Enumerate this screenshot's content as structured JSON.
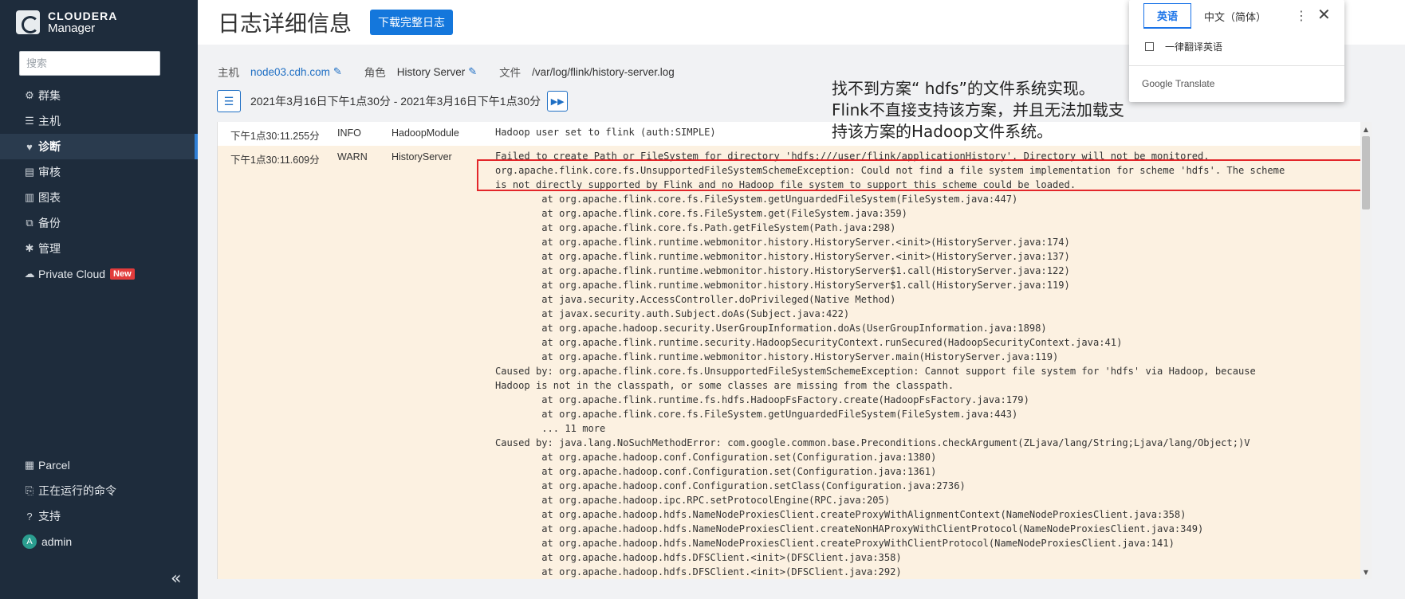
{
  "sidebar": {
    "brand": "CLOUDERA",
    "product": "Manager",
    "search_placeholder": "搜索",
    "items": [
      {
        "label": "群集",
        "icon": "cluster-icon",
        "glyph": "⚙"
      },
      {
        "label": "主机",
        "icon": "host-list-icon",
        "glyph": "☰"
      },
      {
        "label": "诊断",
        "icon": "heartbeat-icon",
        "glyph": "♥"
      },
      {
        "label": "审核",
        "icon": "audit-icon",
        "glyph": "▤"
      },
      {
        "label": "图表",
        "icon": "chart-icon",
        "glyph": "▥"
      },
      {
        "label": "备份",
        "icon": "backup-icon",
        "glyph": "⧉"
      },
      {
        "label": "管理",
        "icon": "gear-icon",
        "glyph": "✱"
      },
      {
        "label": "Private Cloud",
        "icon": "cloud-icon",
        "glyph": "☁",
        "badge": "New"
      }
    ],
    "bottom_items": [
      {
        "label": "Parcel",
        "icon": "parcel-icon",
        "glyph": "▦"
      },
      {
        "label": "正在运行的命令",
        "icon": "commands-icon",
        "glyph": "⎘"
      },
      {
        "label": "支持",
        "icon": "help-icon",
        "glyph": "?"
      },
      {
        "label": "admin",
        "avatar": "A"
      }
    ],
    "collapse_glyph": "«"
  },
  "header": {
    "title": "日志详细信息",
    "download_label": "下载完整日志"
  },
  "meta": {
    "host_label": "主机",
    "host_value": "node03.cdh.com",
    "role_label": "角色",
    "role_value": "History Server",
    "file_label": "文件",
    "file_value": "/var/log/flink/history-server.log"
  },
  "range": {
    "text": "2021年3月16日下午1点30分 - 2021年3月16日下午1点30分"
  },
  "log": {
    "rows": [
      {
        "time": "下午1点30:11.255分",
        "level": "INFO",
        "source": "HadoopModule",
        "message": "Hadoop user set to flink (auth:SIMPLE)"
      },
      {
        "time": "下午1点30:11.609分",
        "level": "WARN",
        "source": "HistoryServer",
        "message": "Failed to create Path or FileSystem for directory 'hdfs:///user/flink/applicationHistory'. Directory will not be monitored.\norg.apache.flink.core.fs.UnsupportedFileSystemSchemeException: Could not find a file system implementation for scheme 'hdfs'. The scheme\nis not directly supported by Flink and no Hadoop file system to support this scheme could be loaded.\n        at org.apache.flink.core.fs.FileSystem.getUnguardedFileSystem(FileSystem.java:447)\n        at org.apache.flink.core.fs.FileSystem.get(FileSystem.java:359)\n        at org.apache.flink.core.fs.Path.getFileSystem(Path.java:298)\n        at org.apache.flink.runtime.webmonitor.history.HistoryServer.<init>(HistoryServer.java:174)\n        at org.apache.flink.runtime.webmonitor.history.HistoryServer.<init>(HistoryServer.java:137)\n        at org.apache.flink.runtime.webmonitor.history.HistoryServer$1.call(HistoryServer.java:122)\n        at org.apache.flink.runtime.webmonitor.history.HistoryServer$1.call(HistoryServer.java:119)\n        at java.security.AccessController.doPrivileged(Native Method)\n        at javax.security.auth.Subject.doAs(Subject.java:422)\n        at org.apache.hadoop.security.UserGroupInformation.doAs(UserGroupInformation.java:1898)\n        at org.apache.flink.runtime.security.HadoopSecurityContext.runSecured(HadoopSecurityContext.java:41)\n        at org.apache.flink.runtime.webmonitor.history.HistoryServer.main(HistoryServer.java:119)\nCaused by: org.apache.flink.core.fs.UnsupportedFileSystemSchemeException: Cannot support file system for 'hdfs' via Hadoop, because\nHadoop is not in the classpath, or some classes are missing from the classpath.\n        at org.apache.flink.runtime.fs.hdfs.HadoopFsFactory.create(HadoopFsFactory.java:179)\n        at org.apache.flink.core.fs.FileSystem.getUnguardedFileSystem(FileSystem.java:443)\n        ... 11 more\nCaused by: java.lang.NoSuchMethodError: com.google.common.base.Preconditions.checkArgument(ZLjava/lang/String;Ljava/lang/Object;)V\n        at org.apache.hadoop.conf.Configuration.set(Configuration.java:1380)\n        at org.apache.hadoop.conf.Configuration.set(Configuration.java:1361)\n        at org.apache.hadoop.conf.Configuration.setClass(Configuration.java:2736)\n        at org.apache.hadoop.ipc.RPC.setProtocolEngine(RPC.java:205)\n        at org.apache.hadoop.hdfs.NameNodeProxiesClient.createProxyWithAlignmentContext(NameNodeProxiesClient.java:358)\n        at org.apache.hadoop.hdfs.NameNodeProxiesClient.createNonHAProxyWithClientProtocol(NameNodeProxiesClient.java:349)\n        at org.apache.hadoop.hdfs.NameNodeProxiesClient.createProxyWithClientProtocol(NameNodeProxiesClient.java:141)\n        at org.apache.hadoop.hdfs.DFSClient.<init>(DFSClient.java:358)\n        at org.apache.hadoop.hdfs.DFSClient.<init>(DFSClient.java:292)"
      }
    ]
  },
  "overlay_translation": {
    "line1": "找不到方案“ hdfs”的文件系统实现。",
    "line2": "Flink不直接支持该方案，并且无法加载支",
    "line3": "持该方案的Hadoop文件系统。"
  },
  "translate_popup": {
    "tab_english": "英语",
    "tab_chinese": "中文（简体）",
    "always_translate": "一律翻译英语",
    "brand": "Google Translate",
    "more_glyph": "⋮",
    "close_glyph": "✕"
  },
  "colors": {
    "sidebar_bg": "#1e2c3c",
    "accent": "#1477dc",
    "warn_row_bg": "#fcf1e1",
    "highlight_border": "#e3262a",
    "new_badge": "#e23c3c"
  }
}
